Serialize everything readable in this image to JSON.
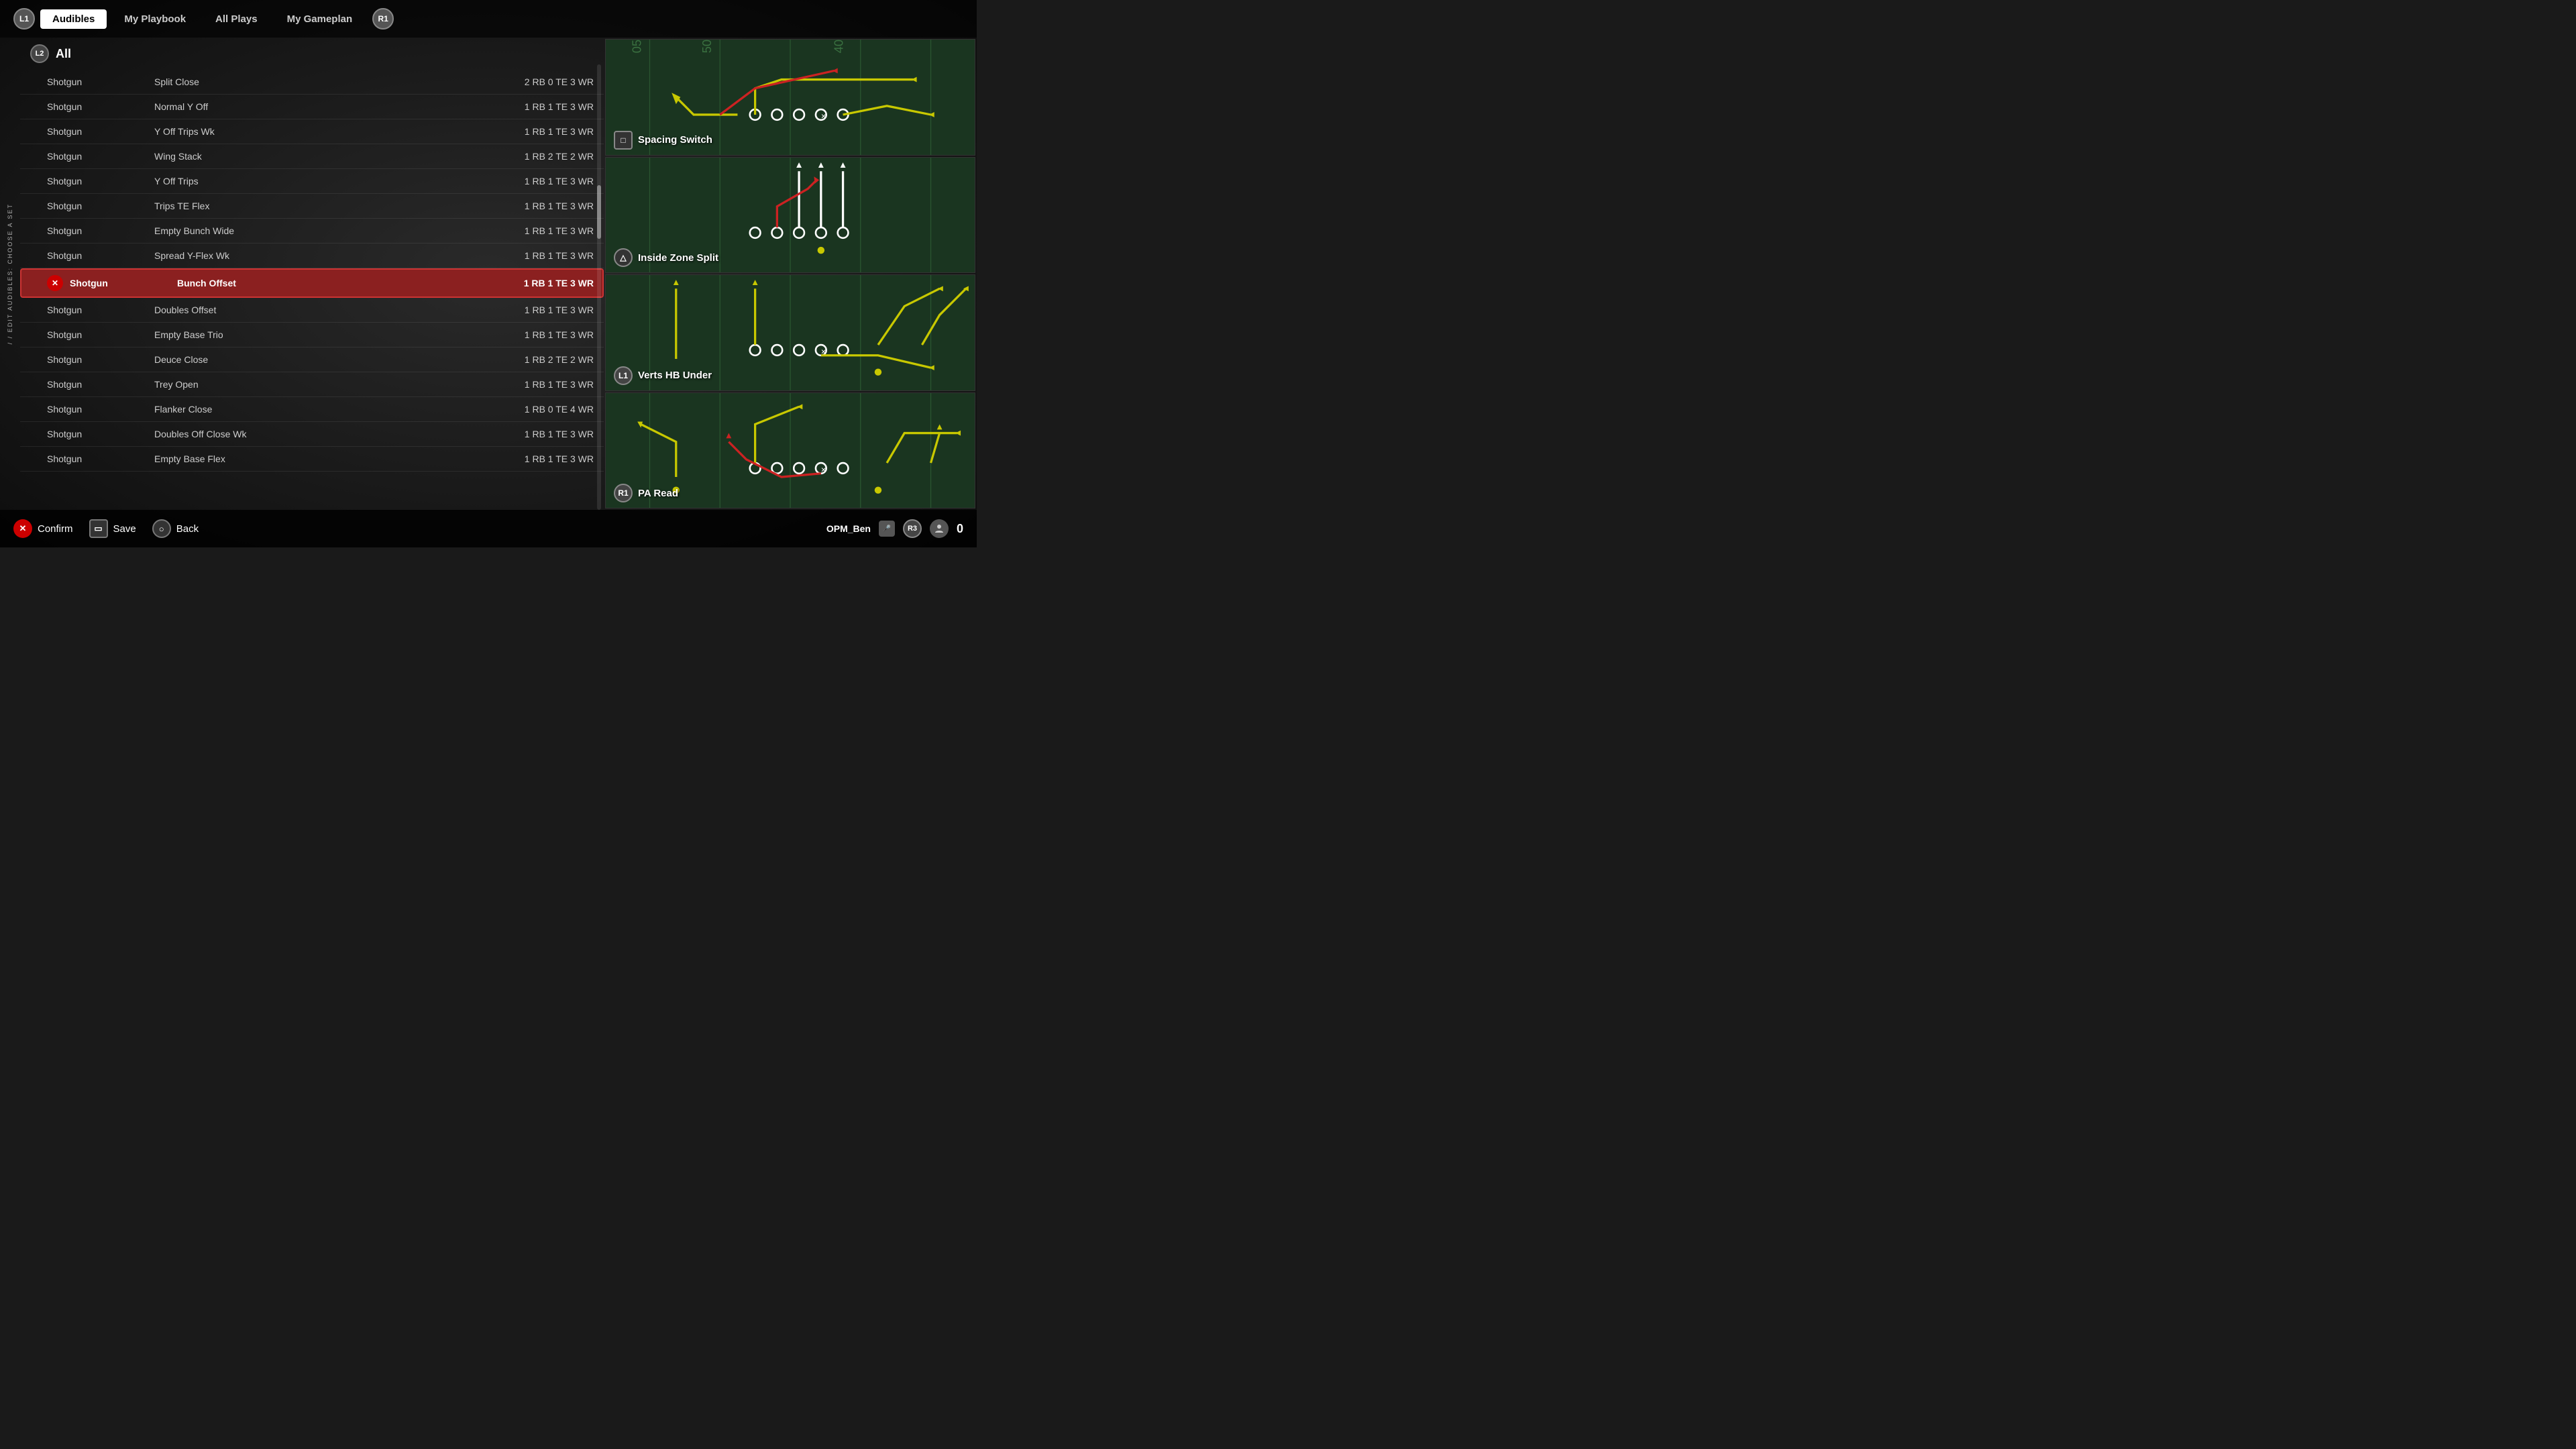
{
  "nav": {
    "l1_label": "L1",
    "active_tab": "Audibles",
    "tabs": [
      "Audibles",
      "My Playbook",
      "All Plays",
      "My Gameplan"
    ],
    "r1_label": "R1"
  },
  "side_label": "/ / EDIT AUDIBLES: CHOOSE A SET",
  "section": {
    "badge": "L2",
    "title": "All"
  },
  "plays": [
    {
      "formation": "Shotgun",
      "name": "Split Close",
      "personnel": "2 RB 0 TE 3 WR",
      "selected": false
    },
    {
      "formation": "Shotgun",
      "name": "Normal Y Off",
      "personnel": "1 RB 1 TE 3 WR",
      "selected": false
    },
    {
      "formation": "Shotgun",
      "name": "Y Off Trips Wk",
      "personnel": "1 RB 1 TE 3 WR",
      "selected": false
    },
    {
      "formation": "Shotgun",
      "name": "Wing Stack",
      "personnel": "1 RB 2 TE 2 WR",
      "selected": false
    },
    {
      "formation": "Shotgun",
      "name": "Y Off Trips",
      "personnel": "1 RB 1 TE 3 WR",
      "selected": false
    },
    {
      "formation": "Shotgun",
      "name": "Trips TE Flex",
      "personnel": "1 RB 1 TE 3 WR",
      "selected": false
    },
    {
      "formation": "Shotgun",
      "name": "Empty Bunch Wide",
      "personnel": "1 RB 1 TE 3 WR",
      "selected": false
    },
    {
      "formation": "Shotgun",
      "name": "Spread Y-Flex Wk",
      "personnel": "1 RB 1 TE 3 WR",
      "selected": false
    },
    {
      "formation": "Shotgun",
      "name": "Bunch Offset",
      "personnel": "1 RB 1 TE 3 WR",
      "selected": true
    },
    {
      "formation": "Shotgun",
      "name": "Doubles Offset",
      "personnel": "1 RB 1 TE 3 WR",
      "selected": false
    },
    {
      "formation": "Shotgun",
      "name": "Empty Base Trio",
      "personnel": "1 RB 1 TE 3 WR",
      "selected": false
    },
    {
      "formation": "Shotgun",
      "name": "Deuce Close",
      "personnel": "1 RB 2 TE 2 WR",
      "selected": false
    },
    {
      "formation": "Shotgun",
      "name": "Trey Open",
      "personnel": "1 RB 1 TE 3 WR",
      "selected": false
    },
    {
      "formation": "Shotgun",
      "name": "Flanker Close",
      "personnel": "1 RB 0 TE 4 WR",
      "selected": false
    },
    {
      "formation": "Shotgun",
      "name": "Doubles Off Close Wk",
      "personnel": "1 RB 1 TE 3 WR",
      "selected": false
    },
    {
      "formation": "Shotgun",
      "name": "Empty Base Flex",
      "personnel": "1 RB 1 TE 3 WR",
      "selected": false
    }
  ],
  "diagrams": [
    {
      "badge_type": "square",
      "badge_label": "□",
      "name": "Spacing Switch",
      "field_color": "#1a3520"
    },
    {
      "badge_type": "triangle",
      "badge_label": "△",
      "name": "Inside Zone Split",
      "field_color": "#1a3520"
    },
    {
      "badge_type": "l1",
      "badge_label": "L1",
      "name": "Verts HB Under",
      "field_color": "#1a3520"
    },
    {
      "badge_type": "r1",
      "badge_label": "R1",
      "name": "PA Read",
      "field_color": "#1a3520"
    }
  ],
  "bottom_bar": {
    "confirm_label": "Confirm",
    "save_label": "Save",
    "back_label": "Back"
  },
  "user": {
    "name": "OPM_Ben",
    "r3_label": "R3",
    "score": "0"
  }
}
